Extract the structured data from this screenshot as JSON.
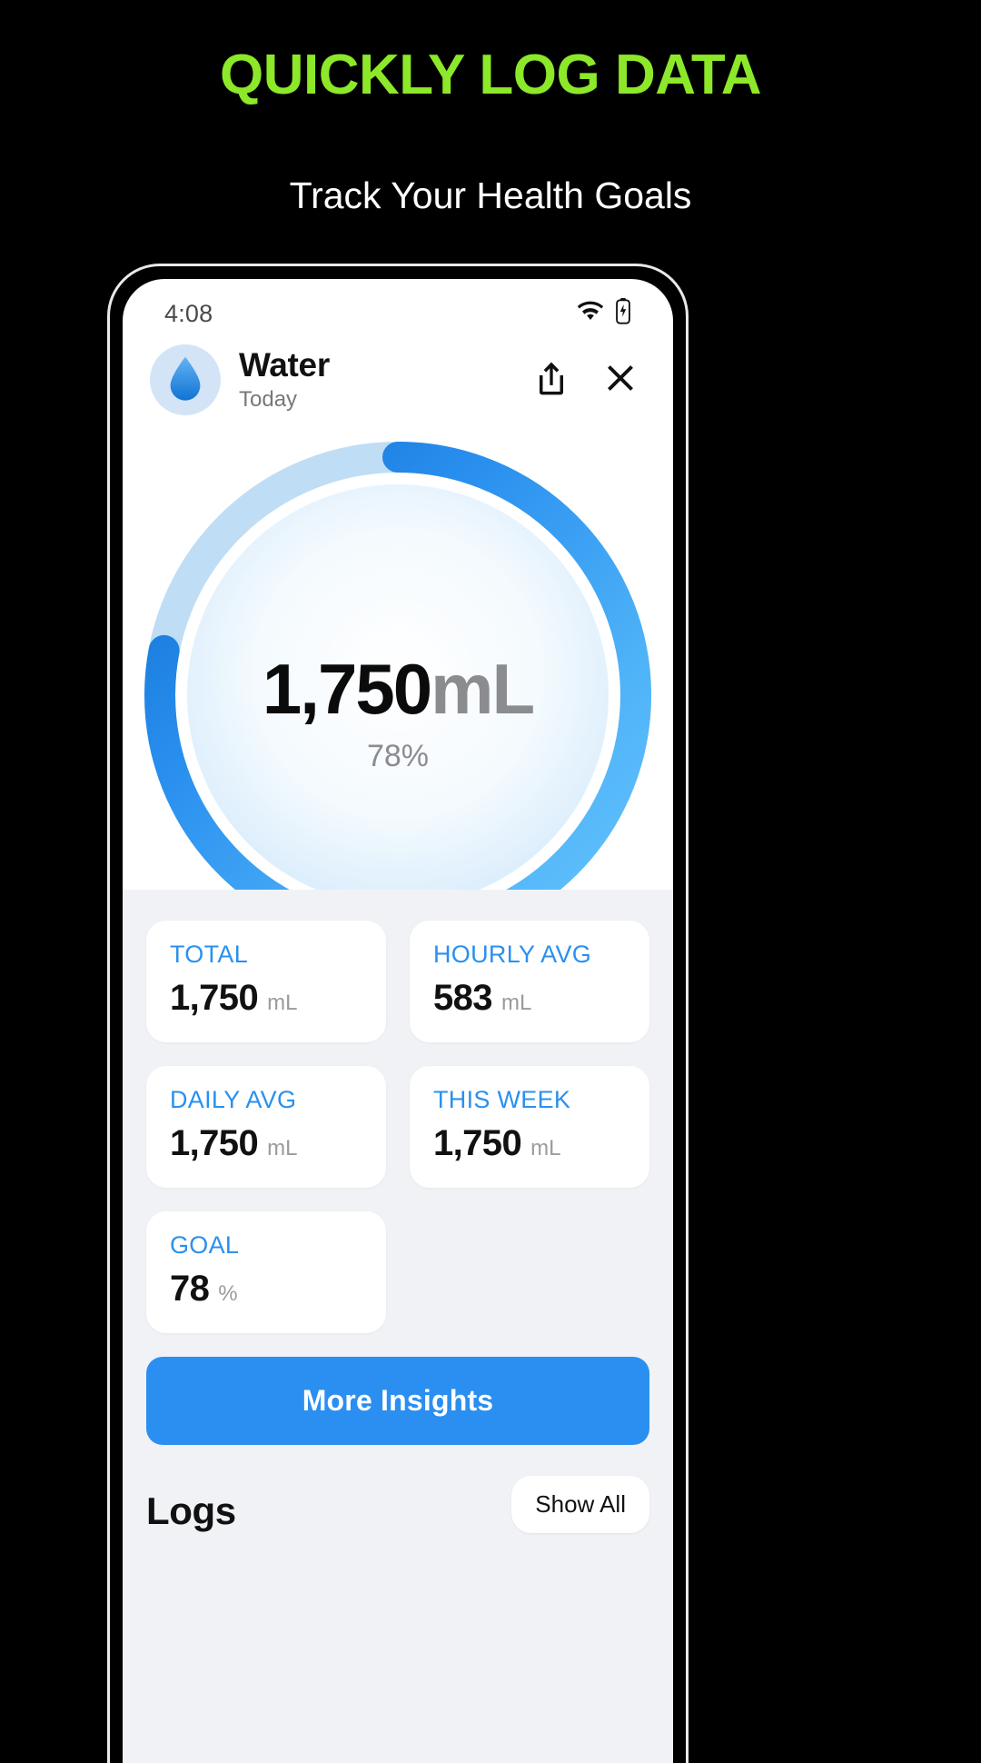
{
  "promo": {
    "headline": "QUICKLY LOG DATA",
    "subhead": "Track Your Health Goals",
    "headline_color": "#8CE829",
    "background_color": "#000000"
  },
  "status_bar": {
    "time": "4:08",
    "wifi_icon": "wifi-icon",
    "battery_icon": "battery-charging-icon"
  },
  "app_header": {
    "icon": "water-drop-icon",
    "title": "Water",
    "subtitle": "Today",
    "share_label": "share-icon",
    "close_label": "close-icon"
  },
  "ring": {
    "value": "1,750",
    "unit": "mL",
    "percent_label": "78%",
    "percent": 78,
    "track_color": "#bfddf5",
    "progress_color_start": "#5ec2fb",
    "progress_color_end": "#1173d4"
  },
  "stats": [
    {
      "label": "TOTAL",
      "value": "1,750",
      "unit": "mL"
    },
    {
      "label": "HOURLY AVG",
      "value": "583",
      "unit": "mL"
    },
    {
      "label": "DAILY AVG",
      "value": "1,750",
      "unit": "mL"
    },
    {
      "label": "THIS WEEK",
      "value": "1,750",
      "unit": "mL"
    },
    {
      "label": "GOAL",
      "value": "78",
      "unit": "%"
    }
  ],
  "actions": {
    "insights_label": "More Insights",
    "insights_color": "#2a8ff0"
  },
  "logs": {
    "title": "Logs",
    "show_all_label": "Show All"
  }
}
